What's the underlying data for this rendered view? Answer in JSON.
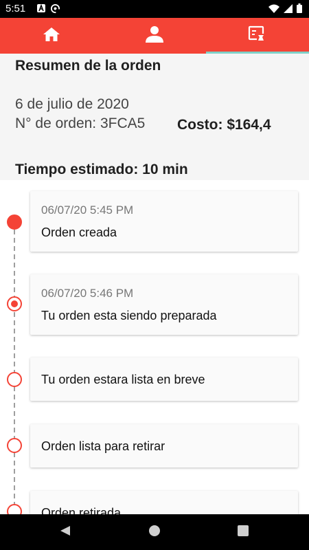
{
  "status_bar": {
    "time": "5:51",
    "icons": [
      "notification-a-icon",
      "sync-icon",
      "wifi-icon",
      "signal-icon",
      "battery-icon"
    ]
  },
  "tabs": [
    {
      "icon": "home-icon",
      "selected": false
    },
    {
      "icon": "person-icon",
      "selected": false
    },
    {
      "icon": "receipt-icon",
      "selected": true
    }
  ],
  "colors": {
    "primary": "#f44336",
    "indicator": "#7fd1c8",
    "summary_bg": "#f5f5f5"
  },
  "summary": {
    "title": "Resumen de la orden",
    "date": "6 de julio de 2020",
    "order_number": "N° de orden: 3FCA5",
    "cost": "Costo: $164,4",
    "estimated_time": "Tiempo estimado: 10 min"
  },
  "timeline": [
    {
      "timestamp": "06/07/20 5:45 PM",
      "label": "Orden creada",
      "state": "done"
    },
    {
      "timestamp": "06/07/20 5:46 PM",
      "label": "Tu orden esta siendo preparada",
      "state": "current"
    },
    {
      "timestamp": "",
      "label": "Tu orden estara lista en breve",
      "state": "pending"
    },
    {
      "timestamp": "",
      "label": "Orden lista para retirar",
      "state": "pending"
    },
    {
      "timestamp": "",
      "label": "Orden retirada",
      "state": "pending"
    }
  ],
  "nav": [
    "back-icon",
    "home-circle-icon",
    "recents-icon"
  ]
}
